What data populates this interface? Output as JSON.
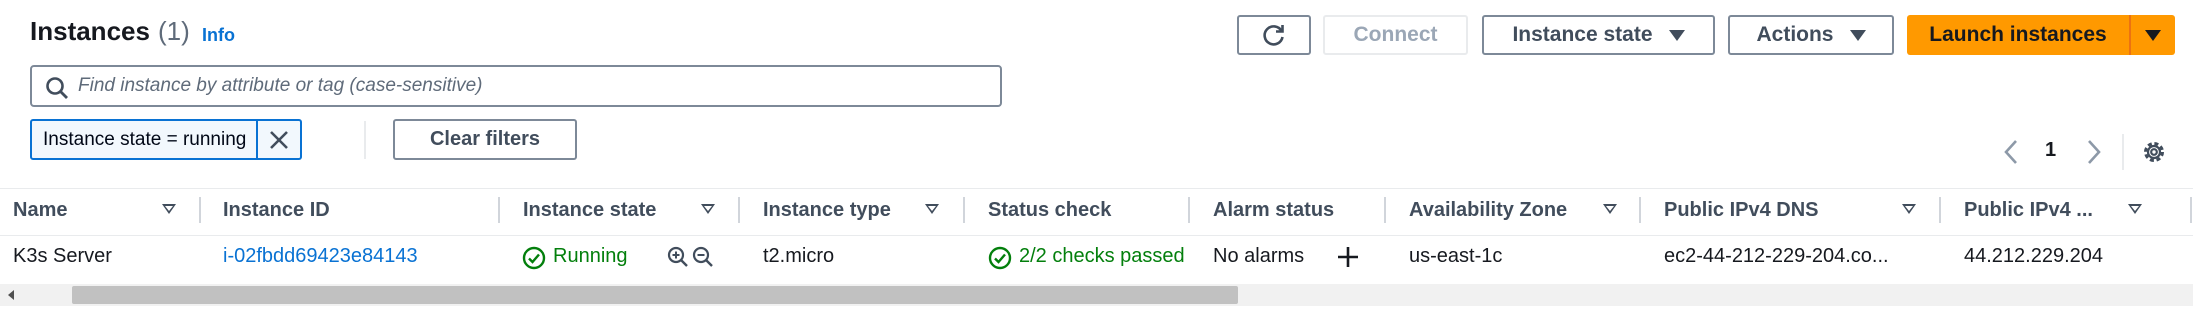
{
  "header": {
    "title": "Instances",
    "count": "(1)",
    "info_link": "Info"
  },
  "toolbar": {
    "connect_label": "Connect",
    "instance_state_label": "Instance state",
    "actions_label": "Actions",
    "launch_label": "Launch instances"
  },
  "search": {
    "placeholder": "Find instance by attribute or tag (case-sensitive)",
    "value": ""
  },
  "filters": {
    "token_label": "Instance state = running",
    "clear_label": "Clear filters"
  },
  "pagination": {
    "current_page": "1"
  },
  "table": {
    "columns": [
      "Name",
      "Instance ID",
      "Instance state",
      "Instance type",
      "Status check",
      "Alarm status",
      "Availability Zone",
      "Public IPv4 DNS",
      "Public IPv4 ..."
    ],
    "rows": [
      {
        "name": "K3s Server",
        "instance_id": "i-02fbdd69423e84143",
        "state": "Running",
        "type": "t2.micro",
        "status_check": "2/2 checks passed",
        "alarm_status": "No alarms",
        "az": "us-east-1c",
        "dns": "ec2-44-212-229-204.co...",
        "ipv4": "44.212.229.204"
      }
    ]
  },
  "colors": {
    "accent": "#0972d3",
    "launch": "#ff9900",
    "success": "#037f0c"
  },
  "icons": [
    "refresh-icon",
    "search-icon",
    "close-icon",
    "chevron-left-icon",
    "chevron-right-icon",
    "settings-gear-icon",
    "status-success-icon",
    "zoom-in-icon",
    "zoom-out-icon",
    "add-icon",
    "caret-down-icon",
    "scroll-left-icon"
  ]
}
